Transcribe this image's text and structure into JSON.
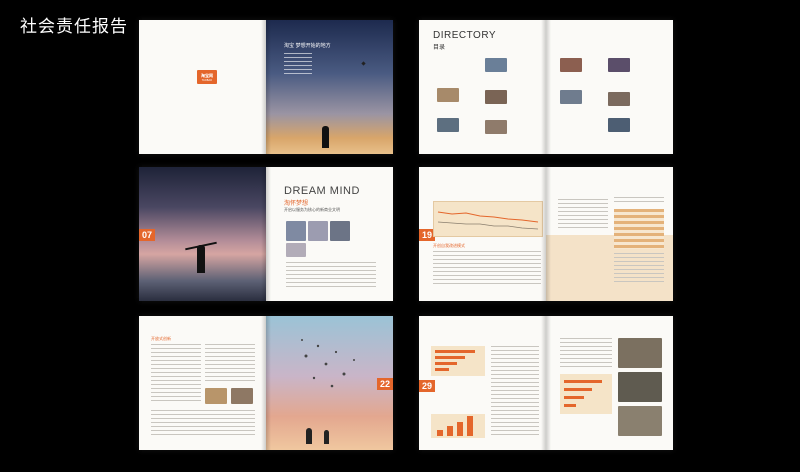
{
  "header": {
    "title": "社会责任报告"
  },
  "spread1": {
    "logo_text": "淘宝网",
    "logo_sub": "TAOBAO",
    "heading": "淘宝 梦想开始的地方"
  },
  "spread2": {
    "heading_en": "DIRECTORY",
    "heading_cn": "目录"
  },
  "spread3": {
    "page_num": "07",
    "heading_en": "DREAM MIND",
    "heading_cn": "淘怀梦想",
    "subheading": "开启以服务为核心的新商业文明"
  },
  "spread4": {
    "page_num": "19",
    "section": "开创自我改进模式"
  },
  "spread5": {
    "page_num": "22",
    "section": "开放式创新"
  },
  "spread6": {
    "page_num": "29"
  },
  "colors": {
    "accent": "#e4662b",
    "background": "#000000"
  }
}
